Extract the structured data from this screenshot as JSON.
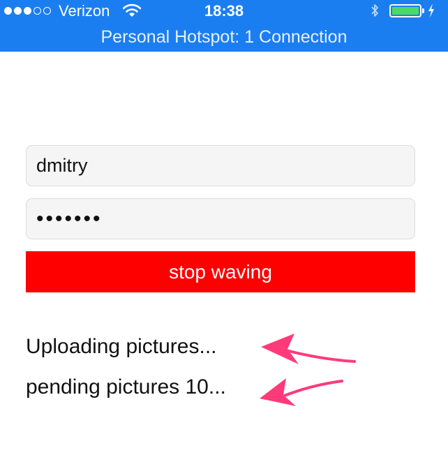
{
  "status_bar": {
    "carrier": "Verizon",
    "time": "18:38",
    "signal_bars_filled": 3,
    "signal_bars_total": 5,
    "battery_level": 1.0,
    "battery_color": "#4cd964",
    "icons": [
      "wifi-icon",
      "bluetooth-icon",
      "battery-icon",
      "charging-bolt-icon"
    ]
  },
  "hotspot_banner": {
    "text": "Personal Hotspot: 1 Connection",
    "color": "#1b7ef0"
  },
  "form": {
    "username_value": "dmitry",
    "password_value": "•••••••",
    "button_label": "stop waving",
    "button_color": "#ff0000"
  },
  "messages": {
    "uploading": "Uploading pictures...",
    "pending": "pending pictures 10..."
  },
  "annotation_arrow_color": "#ff3a7a"
}
